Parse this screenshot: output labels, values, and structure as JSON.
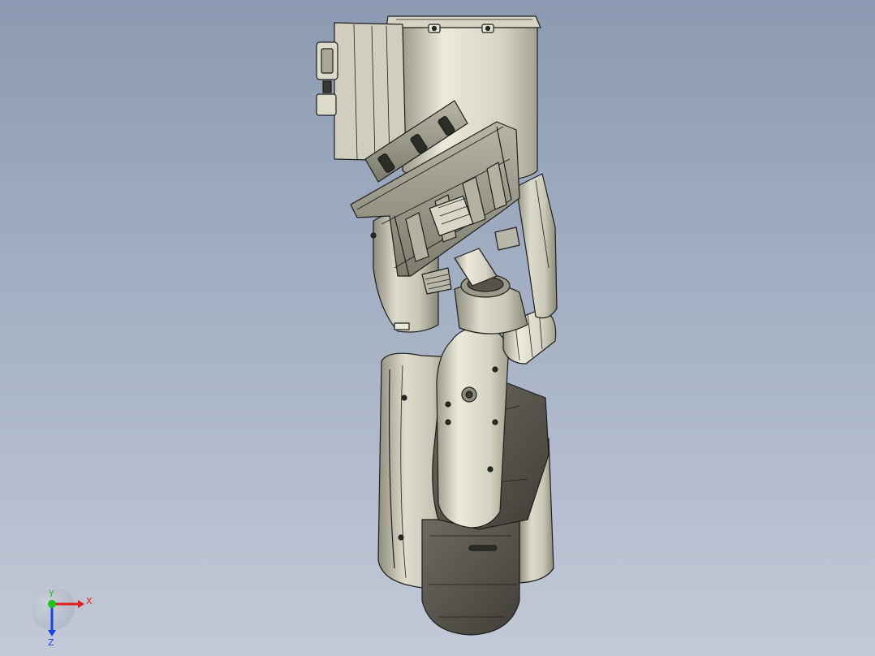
{
  "viewport": {
    "background_top": "#8b9ab2",
    "background_bottom": "#c2cad8"
  },
  "model": {
    "body_color": "#c8c6b4",
    "shadow_color": "#6f6d5f",
    "dark_color": "#4e4c44",
    "edge_color": "#1e1e1e"
  },
  "triad": {
    "x_label": "X",
    "y_label": "Y",
    "z_label": "Z",
    "x_color": "#e02020",
    "y_color": "#20c020",
    "z_color": "#2040e0"
  }
}
